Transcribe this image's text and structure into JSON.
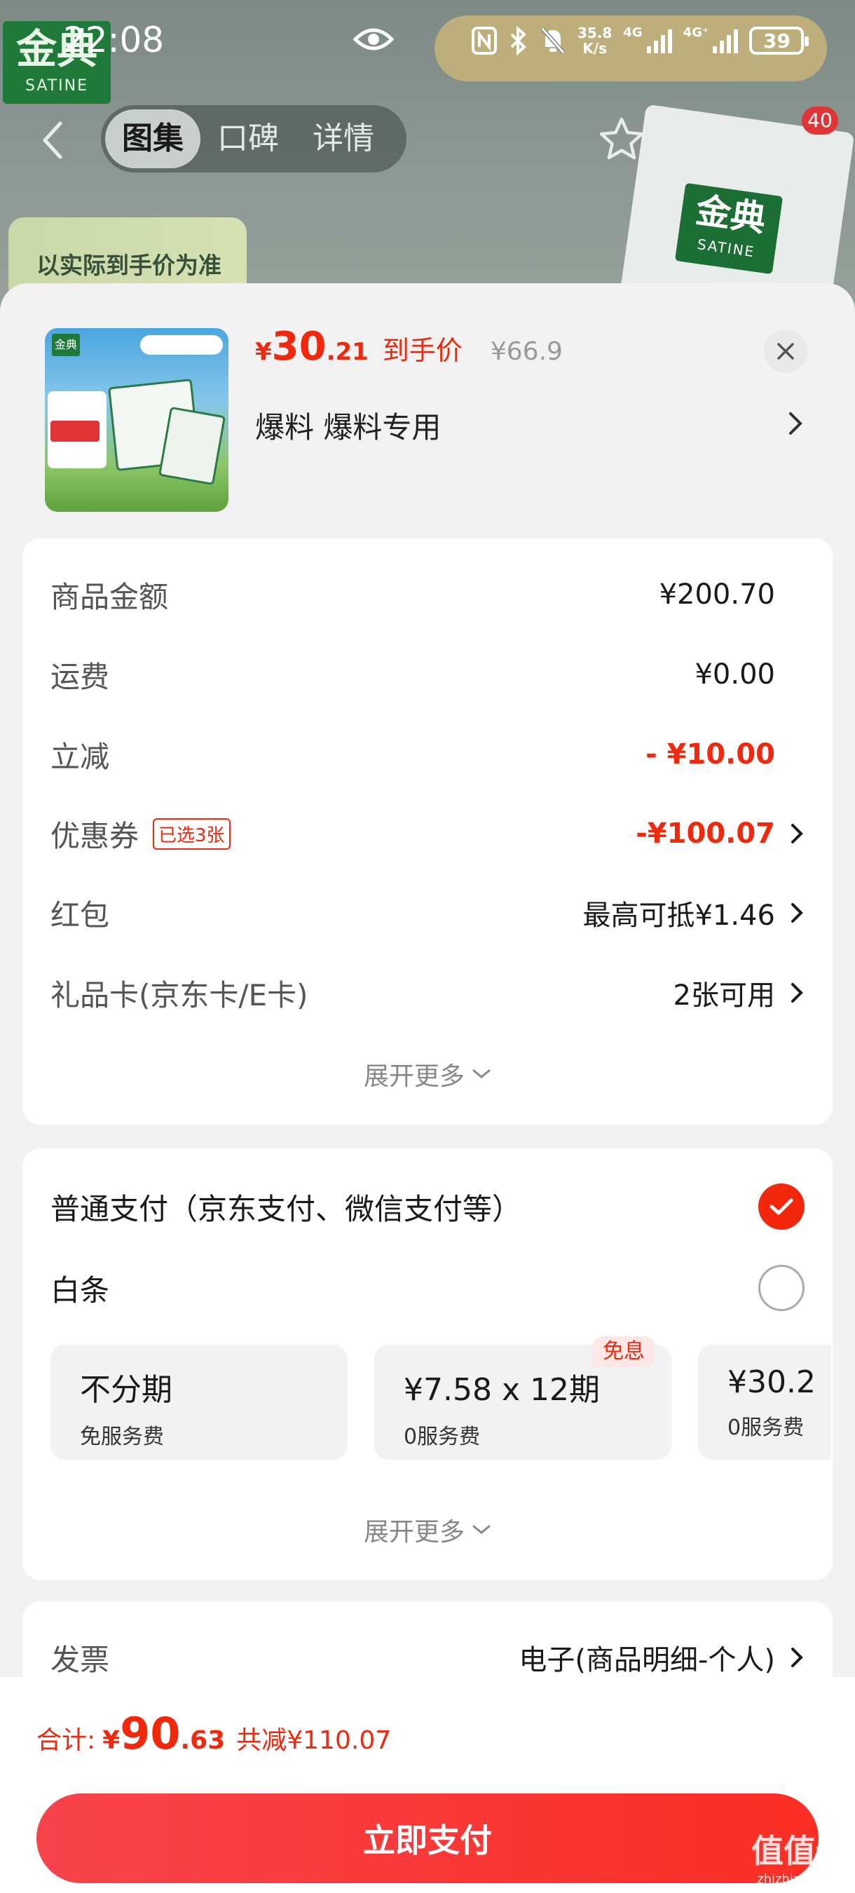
{
  "status_bar": {
    "time": "22:08",
    "net_speed_top": "35.8",
    "net_speed_unit": "K/s",
    "net_type_1": "4G",
    "net_type_2": "4G⁺",
    "battery": "39"
  },
  "backdrop": {
    "brand_cn": "金典",
    "brand_en": "SATINE",
    "promo_text": "以实际到手价为准"
  },
  "nav": {
    "tabs": [
      "图集",
      "口碑",
      "详情"
    ],
    "active_tab": "图集",
    "cart_badge": "40"
  },
  "product": {
    "price_symbol": "¥",
    "price_int": "30",
    "price_dec": ".21",
    "price_tag": "到手价",
    "original_price": "¥66.9",
    "name": "爆料  爆料专用",
    "thumb_logo": "金典"
  },
  "summary": {
    "rows": [
      {
        "label": "商品金额",
        "value": "¥200.70"
      },
      {
        "label": "运费",
        "value": "¥0.00"
      },
      {
        "label": "立减",
        "value": "- ¥10.00"
      },
      {
        "label": "优惠券",
        "tag": "已选3张",
        "value": "-¥100.07"
      },
      {
        "label": "红包",
        "value": "最高可抵¥1.46"
      },
      {
        "label": "礼品卡(京东卡/E卡)",
        "value": "2张可用"
      }
    ],
    "expand_label": "展开更多"
  },
  "payment": {
    "options": [
      {
        "label": "普通支付（京东支付、微信支付等）",
        "selected": true
      },
      {
        "label": "白条",
        "selected": false
      }
    ],
    "free_interest_badge": "免息",
    "plans": [
      {
        "main": "不分期",
        "sub": "免服务费"
      },
      {
        "main": "¥7.58 x 12期",
        "sub": "0服务费"
      },
      {
        "main": "¥30.2",
        "sub": "0服务费"
      }
    ],
    "expand_label": "展开更多"
  },
  "invoice": {
    "label": "发票",
    "value": "电子(商品明细-个人)"
  },
  "footer": {
    "total_label": "合计:",
    "total_symbol": "¥",
    "total_int": "90",
    "total_dec": ".63",
    "total_saving": "共减¥110.07",
    "pay_button": "立即支付"
  },
  "watermark": {
    "main": "值值值",
    "sub": "zhizhizhi.com"
  },
  "colors": {
    "accent_red": "#f2270c",
    "sheet_bg": "#f2f2f2",
    "card_bg": "#ffffff"
  }
}
